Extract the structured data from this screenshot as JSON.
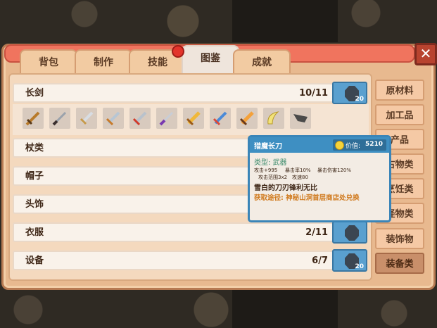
{
  "tabs": [
    {
      "label": "背包"
    },
    {
      "label": "制作"
    },
    {
      "label": "技能"
    },
    {
      "label": "图鉴"
    },
    {
      "label": "成就"
    }
  ],
  "active_tab": "图鉴",
  "close_label": "✕",
  "categories": [
    {
      "name": "长剑",
      "count": "10/11",
      "badge": "20"
    },
    {
      "name": "杖类",
      "count": "",
      "badge": ""
    },
    {
      "name": "帽子",
      "count": "",
      "badge": ""
    },
    {
      "name": "头饰",
      "count": "",
      "badge": ""
    },
    {
      "name": "衣服",
      "count": "2/11",
      "badge": ""
    },
    {
      "name": "设备",
      "count": "6/7",
      "badge": "20"
    }
  ],
  "sidebar": [
    {
      "label": "原材料"
    },
    {
      "label": "加工品"
    },
    {
      "label": "产品"
    },
    {
      "label": "古物类"
    },
    {
      "label": "烹饪类"
    },
    {
      "label": "怪物类"
    },
    {
      "label": "装饰物"
    },
    {
      "label": "装备类"
    }
  ],
  "items_strip": {
    "item_icons": [
      "wooden-sword-icon",
      "iron-sword-icon",
      "dagger-icon",
      "steel-sword-icon",
      "red-sword-icon",
      "purple-sword-icon",
      "golden-sword-icon",
      "blue-sword-icon",
      "flame-sword-icon",
      "scimitar-icon",
      "locked-sword-icon"
    ]
  },
  "tooltip": {
    "name": "猎魔长刀",
    "price_label": "价值:",
    "price_value": "5210",
    "type": "类型: 武器",
    "attack": "攻击+995",
    "crit_rate": "暴击率10%",
    "crit_damage": "暴击伤害120%",
    "range": "攻击范围3x2",
    "speed": "攻速80",
    "description": "雪白的刀刃锋利无比",
    "source": "获取途径: 神秘山洞首层商店处兑换"
  },
  "colors": {
    "panel": "#e8b98f",
    "tooltip_border": "#3a85b8",
    "close": "#b8432f",
    "gem_box": "#5aa0cf"
  }
}
